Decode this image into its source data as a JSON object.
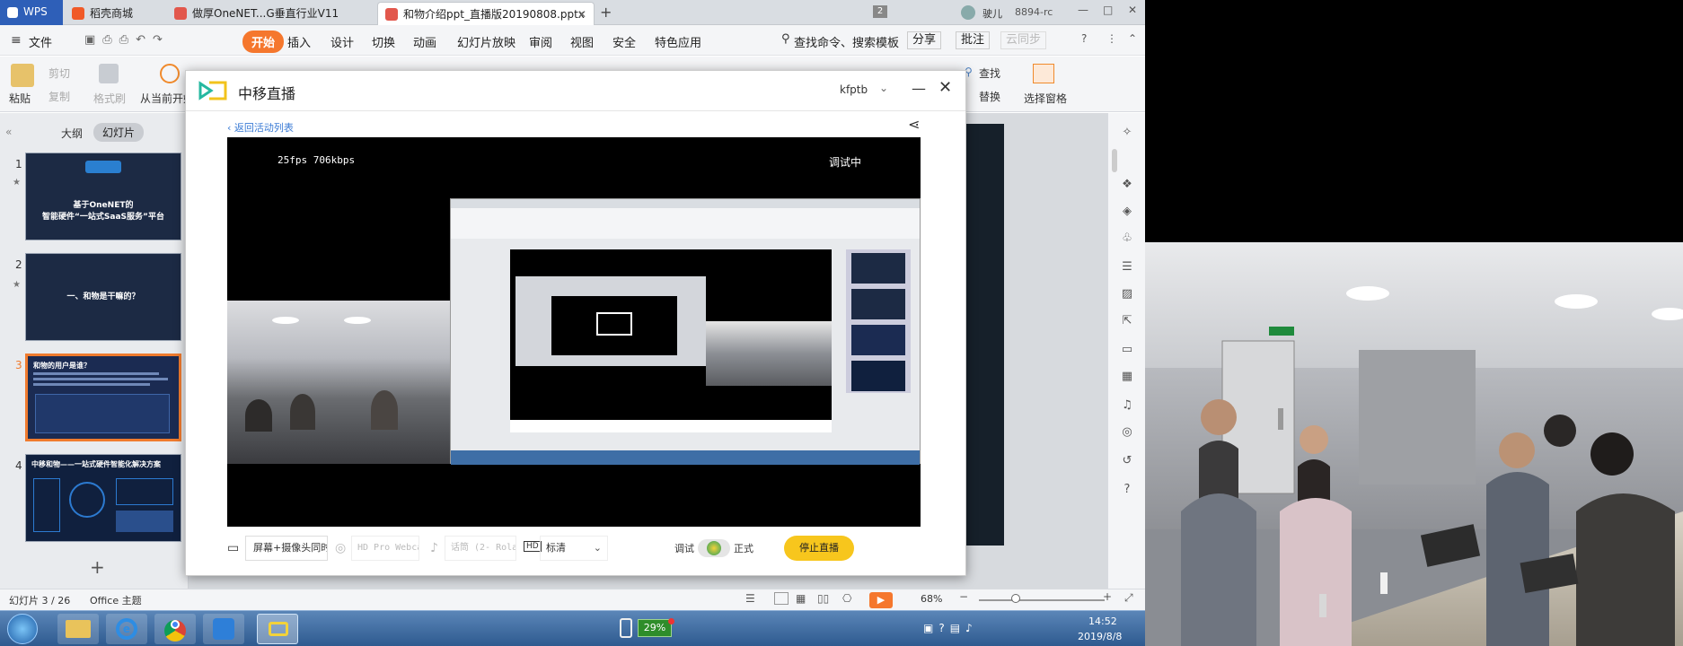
{
  "tabs": [
    {
      "label": "WPS"
    },
    {
      "label": "稻壳商城"
    },
    {
      "label": "做厚OneNET...G垂直行业V11"
    },
    {
      "label": "和物介绍ppt_直播版20190808.pptx"
    }
  ],
  "titlebar": {
    "badge": "2",
    "user": "驶儿",
    "extra": "8894-rc"
  },
  "menu": {
    "file": "文件",
    "items": [
      "开始",
      "插入",
      "设计",
      "切换",
      "动画",
      "幻灯片放映",
      "审阅",
      "视图",
      "安全",
      "特色应用"
    ],
    "search": "查找命令、搜索模板",
    "share": "分享",
    "comment": "批注",
    "sync": "云同步"
  },
  "ribbon": {
    "paste": "粘贴",
    "cut": "剪切",
    "copy": "复制",
    "format": "格式刷",
    "from_current": "从当前开始",
    "find": "查找",
    "replace": "替换",
    "select_pane": "选择窗格"
  },
  "side_panel": {
    "tab_outline": "大纲",
    "tab_slides": "幻灯片",
    "slides": [
      {
        "num": "1",
        "title": "基于OneNET的\n智能硬件“一站式SaaS服务”平台"
      },
      {
        "num": "2",
        "title": "一、和物是干嘛的？"
      },
      {
        "num": "3",
        "title": "和物的用户是谁？"
      },
      {
        "num": "4",
        "title": "中移和物——一站式硬件智能化解决方案"
      }
    ],
    "add": "+"
  },
  "status": {
    "slide_info": "幻灯片 3 / 26",
    "theme": "Office 主题",
    "zoom": "68%"
  },
  "taskbar": {
    "battery": "29%",
    "time": "14:52",
    "date": "2019/8/8"
  },
  "dialog": {
    "title": "中移直播",
    "user": "kfptb",
    "back_link": "返回活动列表",
    "stats": "25fps 706kbps",
    "stream_status": "调试中",
    "source": "屏幕+摄像头同时直",
    "camera": "HD Pro Webcam",
    "mic": "话筒 (2- Rolan",
    "quality_tag": "HD",
    "quality": "标清",
    "mode_debug": "调试",
    "mode_live": "正式",
    "stop_button": "停止直播"
  },
  "colors": {
    "accent_orange": "#f5772d",
    "stop_yellow": "#f7c61d",
    "brand_teal": "#26b8a0",
    "taskbar_blue": "#3e6ea6"
  }
}
